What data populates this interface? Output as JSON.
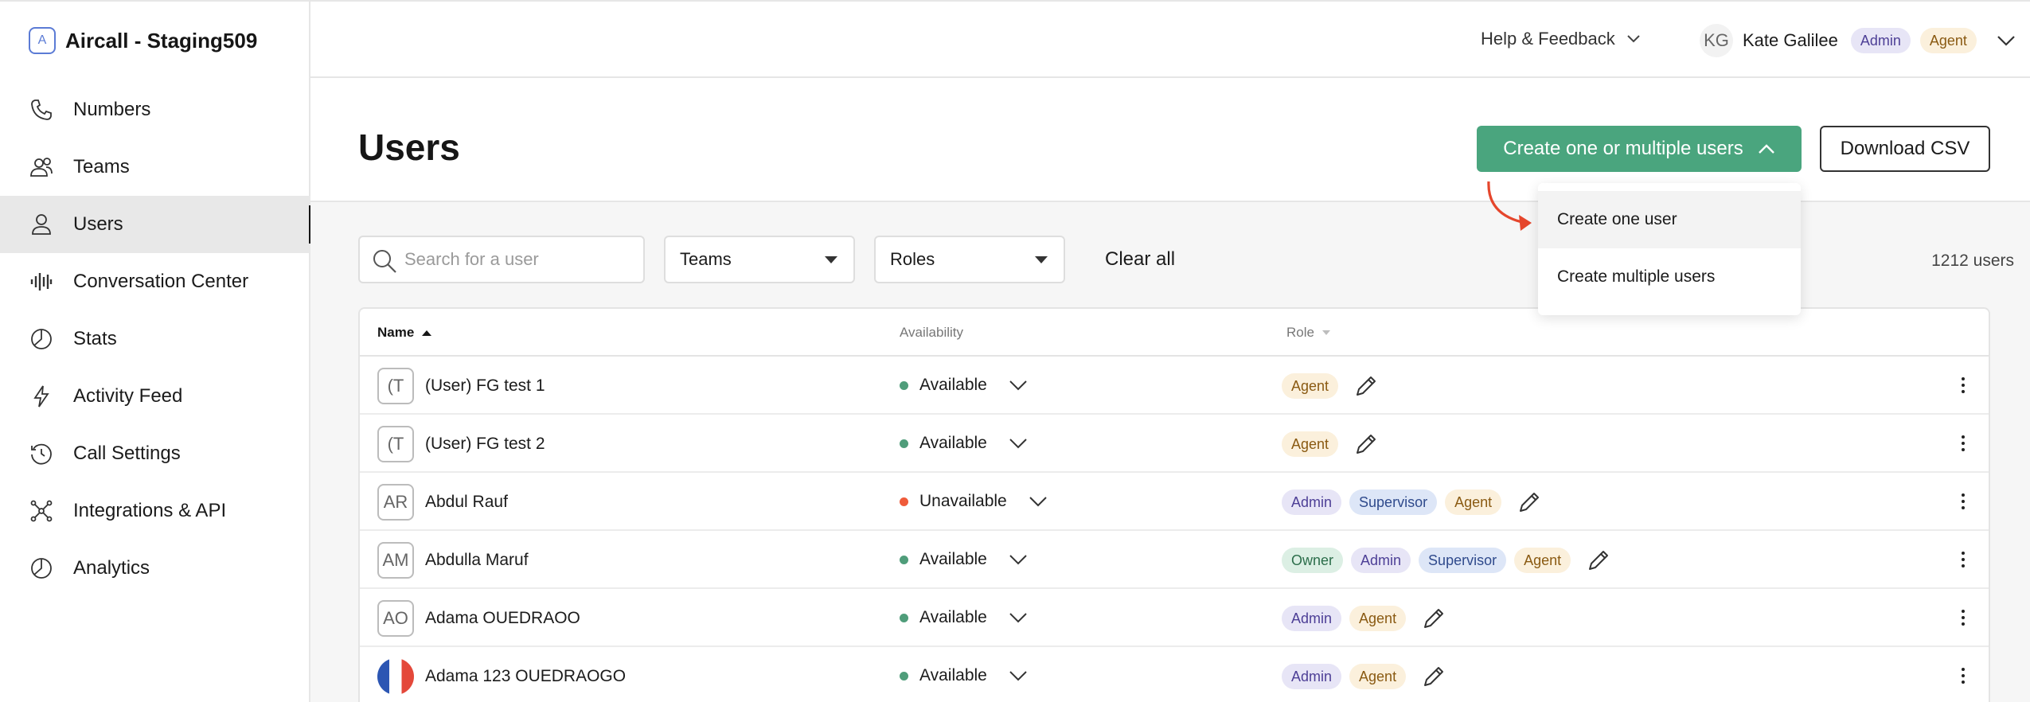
{
  "app": {
    "title": "Aircall - Staging509",
    "logo_letter": "A"
  },
  "sidebar": {
    "items": [
      {
        "label": "Numbers",
        "icon": "phone-icon"
      },
      {
        "label": "Teams",
        "icon": "team-icon"
      },
      {
        "label": "Users",
        "icon": "user-icon",
        "active": true
      },
      {
        "label": "Conversation Center",
        "icon": "waveform-icon"
      },
      {
        "label": "Stats",
        "icon": "pie-chart-icon"
      },
      {
        "label": "Activity Feed",
        "icon": "lightning-icon"
      },
      {
        "label": "Call Settings",
        "icon": "history-icon"
      },
      {
        "label": "Integrations & API",
        "icon": "network-icon"
      },
      {
        "label": "Analytics",
        "icon": "pie-chart-icon"
      }
    ]
  },
  "topbar": {
    "help_label": "Help & Feedback",
    "user_initials": "KG",
    "user_name": "Kate Galilee",
    "user_roles": [
      "Admin",
      "Agent"
    ]
  },
  "page": {
    "title": "Users",
    "create_button": "Create one or multiple users",
    "download_button": "Download CSV",
    "dropdown_items": [
      "Create one user",
      "Create multiple users"
    ]
  },
  "filters": {
    "search_placeholder": "Search for a user",
    "teams_label": "Teams",
    "roles_label": "Roles",
    "clear_all": "Clear all",
    "users_count": "1212 users"
  },
  "table": {
    "columns": {
      "name": "Name",
      "availability": "Availability",
      "role": "Role"
    },
    "rows": [
      {
        "initials": "(T",
        "name": "(User) FG test 1",
        "availability": "Available",
        "status": "available",
        "roles": [
          "Agent"
        ]
      },
      {
        "initials": "(T",
        "name": "(User) FG test 2",
        "availability": "Available",
        "status": "available",
        "roles": [
          "Agent"
        ]
      },
      {
        "initials": "AR",
        "name": "Abdul Rauf",
        "availability": "Unavailable",
        "status": "unavailable",
        "roles": [
          "Admin",
          "Supervisor",
          "Agent"
        ]
      },
      {
        "initials": "AM",
        "name": "Abdulla Maruf",
        "availability": "Available",
        "status": "available",
        "roles": [
          "Owner",
          "Admin",
          "Supervisor",
          "Agent"
        ]
      },
      {
        "initials": "AO",
        "name": "Adama OUEDRAOO",
        "availability": "Available",
        "status": "available",
        "roles": [
          "Admin",
          "Agent"
        ]
      },
      {
        "initials": "",
        "flag": true,
        "name": "Adama 123 OUEDRAOGO",
        "availability": "Available",
        "status": "available",
        "roles": [
          "Admin",
          "Agent"
        ]
      }
    ]
  },
  "colors": {
    "primary_green": "#4aa57e",
    "available": "#4f9d7a",
    "unavailable": "#ef5b3a",
    "annotation_arrow": "#e5462c"
  }
}
